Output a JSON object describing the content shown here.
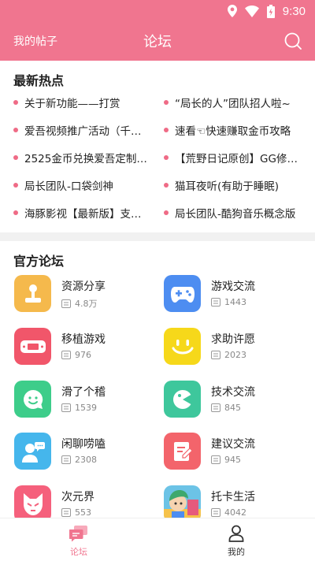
{
  "status": {
    "time": "9:30"
  },
  "header": {
    "left_label": "我的帖子",
    "title": "论坛"
  },
  "hot": {
    "title": "最新热点",
    "items": [
      "关于新功能——打赏",
      "“局长的人”团队招人啦~",
      "爱吾视频推广活动（千万...",
      "速看☜快速赚取金币攻略",
      "2525金币兑换爱吾定制小...",
      "【荒野日记原创】GG修改...",
      "局长团队-口袋剑神",
      "猫耳夜听(有助于睡眠)",
      "海豚影视【最新版】支持...",
      "局长团队-酷狗音乐概念版"
    ]
  },
  "official": {
    "title": "官方论坛",
    "forums": [
      {
        "name": "资源分享",
        "count": "4.8万",
        "icon": "joystick-icon",
        "color": "#f5b94c"
      },
      {
        "name": "游戏交流",
        "count": "1443",
        "icon": "gamepad-icon",
        "color": "#4d8df1"
      },
      {
        "name": "移植游戏",
        "count": "976",
        "icon": "handheld-console-icon",
        "color": "#f1566a"
      },
      {
        "name": "求助许愿",
        "count": "2023",
        "icon": "smiley-icon",
        "color": "#f6d81a"
      },
      {
        "name": "滑了个稽",
        "count": "1539",
        "icon": "chat-smile-icon",
        "color": "#3dcd8a"
      },
      {
        "name": "技术交流",
        "count": "845",
        "icon": "pacman-icon",
        "color": "#3ec79c"
      },
      {
        "name": "闲聊唠嗑",
        "count": "2308",
        "icon": "person-chat-icon",
        "color": "#45b6ec"
      },
      {
        "name": "建议交流",
        "count": "945",
        "icon": "note-edit-icon",
        "color": "#f3646b"
      },
      {
        "name": "次元界",
        "count": "553",
        "icon": "fox-mask-icon",
        "color": "#f5607c"
      },
      {
        "name": "托卡生活",
        "count": "4042",
        "icon": "toca-life-icon",
        "color": "#6cc3e6"
      }
    ]
  },
  "tabs": {
    "forum": "论坛",
    "me": "我的"
  },
  "colors": {
    "brand": "#f0758f",
    "dot": "#ef6b86"
  }
}
